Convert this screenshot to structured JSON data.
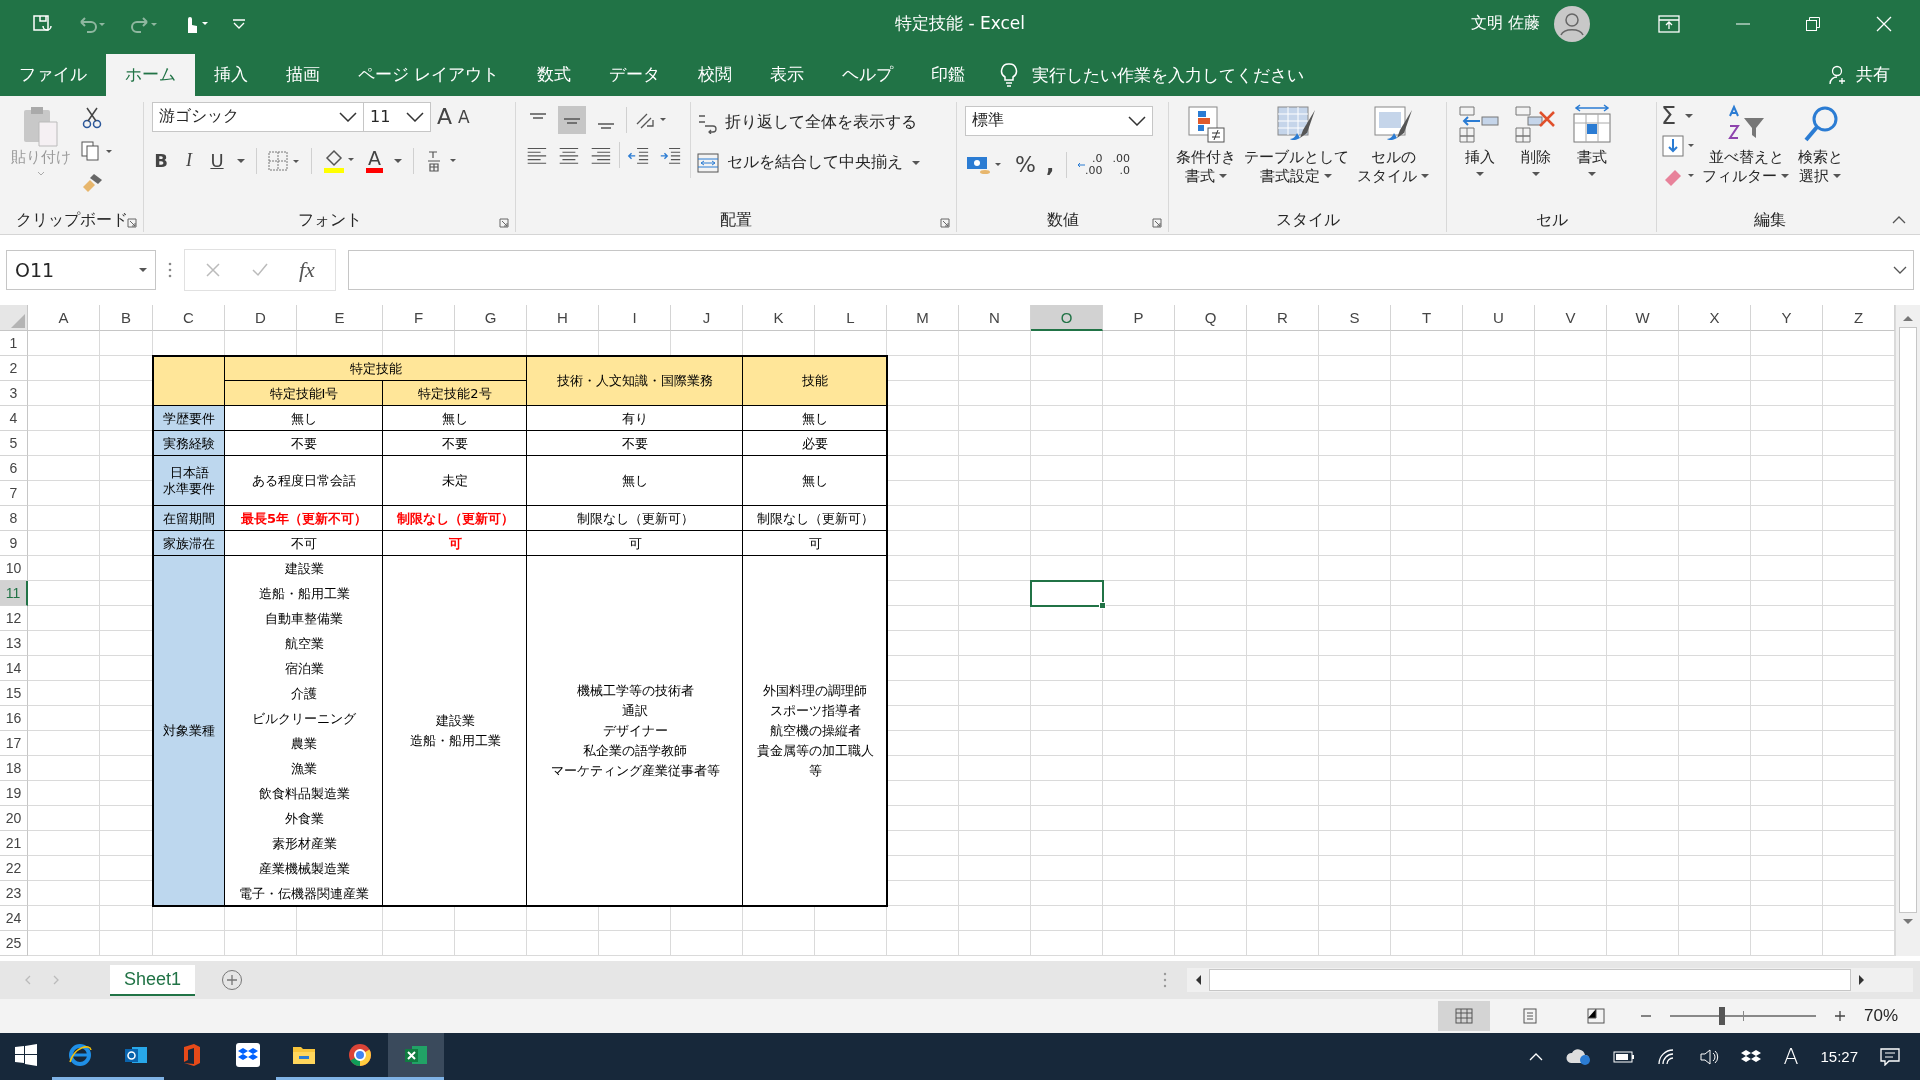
{
  "title_bar": {
    "title": "特定技能  -  Excel",
    "user_name": "文明 佐藤"
  },
  "menu_tabs": [
    {
      "label": "ファイル",
      "selected": false
    },
    {
      "label": "ホーム",
      "selected": true
    },
    {
      "label": "挿入",
      "selected": false
    },
    {
      "label": "描画",
      "selected": false
    },
    {
      "label": "ページ レイアウト",
      "selected": false
    },
    {
      "label": "数式",
      "selected": false
    },
    {
      "label": "データ",
      "selected": false
    },
    {
      "label": "校閲",
      "selected": false
    },
    {
      "label": "表示",
      "selected": false
    },
    {
      "label": "ヘルプ",
      "selected": false
    },
    {
      "label": "印鑑",
      "selected": false
    }
  ],
  "tell_me": {
    "placeholder": "実行したい作業を入力してください"
  },
  "share": "共有",
  "ribbon": {
    "clipboard": {
      "label": "クリップボード",
      "paste": "貼り付け"
    },
    "font": {
      "label": "フォント",
      "font_name": "游ゴシック",
      "font_size": "11",
      "grow": "A",
      "shrink": "A",
      "bold": "B",
      "italic": "I",
      "underline": "U",
      "font_color": "A"
    },
    "alignment": {
      "label": "配置",
      "wrap_text": "折り返して全体を表示する",
      "merge_center": "セルを結合して中央揃え"
    },
    "number": {
      "label": "数値",
      "format": "標準",
      "percent": "%",
      "comma": ",",
      "increase_decimal": [
        ".0",
        ".00"
      ],
      "decrease_decimal": [
        ".00",
        ".0"
      ]
    },
    "styles": {
      "label": "スタイル",
      "buttons": [
        {
          "lines": [
            "条件付き",
            "書式"
          ]
        },
        {
          "lines": [
            "テーブルとして",
            "書式設定"
          ]
        },
        {
          "lines": [
            "セルの",
            "スタイル"
          ]
        }
      ]
    },
    "cells": {
      "label": "セル",
      "buttons": [
        "挿入",
        "削除",
        "書式"
      ]
    },
    "editing": {
      "label": "編集",
      "autosum": "Σ",
      "buttons": [
        {
          "lines": [
            "並べ替えと",
            "フィルター"
          ]
        },
        {
          "lines": [
            "検索と",
            "選択"
          ]
        }
      ]
    }
  },
  "formula_bar": {
    "name_box": "O11",
    "function_label": "fx"
  },
  "sheet": {
    "columns": [
      {
        "label": "A",
        "selected": false
      },
      {
        "label": "B",
        "selected": false
      },
      {
        "label": "C",
        "selected": false
      },
      {
        "label": "D",
        "selected": false
      },
      {
        "label": "E",
        "selected": false
      },
      {
        "label": "F",
        "selected": false
      },
      {
        "label": "G",
        "selected": false
      },
      {
        "label": "H",
        "selected": false
      },
      {
        "label": "I",
        "selected": false
      },
      {
        "label": "J",
        "selected": false
      },
      {
        "label": "K",
        "selected": false
      },
      {
        "label": "L",
        "selected": false
      },
      {
        "label": "M",
        "selected": false
      },
      {
        "label": "N",
        "selected": false
      },
      {
        "label": "O",
        "selected": true
      },
      {
        "label": "P",
        "selected": false
      },
      {
        "label": "Q",
        "selected": false
      },
      {
        "label": "R",
        "selected": false
      },
      {
        "label": "S",
        "selected": false
      },
      {
        "label": "T",
        "selected": false
      },
      {
        "label": "U",
        "selected": false
      },
      {
        "label": "V",
        "selected": false
      },
      {
        "label": "W",
        "selected": false
      },
      {
        "label": "X",
        "selected": false
      },
      {
        "label": "Y",
        "selected": false
      },
      {
        "label": "Z",
        "selected": false
      }
    ],
    "rows": [
      {
        "label": "1",
        "selected": false
      },
      {
        "label": "2",
        "selected": false
      },
      {
        "label": "3",
        "selected": false
      },
      {
        "label": "4",
        "selected": false
      },
      {
        "label": "5",
        "selected": false
      },
      {
        "label": "6",
        "selected": false
      },
      {
        "label": "7",
        "selected": false
      },
      {
        "label": "8",
        "selected": false
      },
      {
        "label": "9",
        "selected": false
      },
      {
        "label": "10",
        "selected": false
      },
      {
        "label": "11",
        "selected": true
      },
      {
        "label": "12",
        "selected": false
      },
      {
        "label": "13",
        "selected": false
      },
      {
        "label": "14",
        "selected": false
      },
      {
        "label": "15",
        "selected": false
      },
      {
        "label": "16",
        "selected": false
      },
      {
        "label": "17",
        "selected": false
      },
      {
        "label": "18",
        "selected": false
      },
      {
        "label": "19",
        "selected": false
      },
      {
        "label": "20",
        "selected": false
      },
      {
        "label": "21",
        "selected": false
      },
      {
        "label": "22",
        "selected": false
      },
      {
        "label": "23",
        "selected": false
      },
      {
        "label": "24",
        "selected": false
      },
      {
        "label": "25",
        "selected": false
      }
    ],
    "table": {
      "group_header": "特定技能",
      "columns": [
        "特定技能Ⅰ号",
        "特定技能2号",
        "技術・人文知識・国際業務",
        "技能"
      ],
      "rows": [
        {
          "label_lines": [
            "学歴要件"
          ],
          "cells": [
            {
              "lines": [
                "無し"
              ],
              "highlighted": false
            },
            {
              "lines": [
                "無し"
              ],
              "highlighted": false
            },
            {
              "lines": [
                "有り"
              ],
              "highlighted": false
            },
            {
              "lines": [
                "無し"
              ],
              "highlighted": false
            }
          ]
        },
        {
          "label_lines": [
            "実務経験"
          ],
          "cells": [
            {
              "lines": [
                "不要"
              ],
              "highlighted": false
            },
            {
              "lines": [
                "不要"
              ],
              "highlighted": false
            },
            {
              "lines": [
                "不要"
              ],
              "highlighted": false
            },
            {
              "lines": [
                "必要"
              ],
              "highlighted": false
            }
          ]
        },
        {
          "label_lines": [
            "日本語",
            "水準要件"
          ],
          "cells": [
            {
              "lines": [
                "ある程度日常会話"
              ],
              "highlighted": false
            },
            {
              "lines": [
                "未定"
              ],
              "highlighted": false
            },
            {
              "lines": [
                "無し"
              ],
              "highlighted": false
            },
            {
              "lines": [
                "無し"
              ],
              "highlighted": false
            }
          ]
        },
        {
          "label_lines": [
            "在留期間"
          ],
          "cells": [
            {
              "lines": [
                "最長5年（更新不可）"
              ],
              "highlighted": true
            },
            {
              "lines": [
                "制限なし（更新可）"
              ],
              "highlighted": true
            },
            {
              "lines": [
                "制限なし（更新可）"
              ],
              "highlighted": false
            },
            {
              "lines": [
                "制限なし（更新可）"
              ],
              "highlighted": false
            }
          ]
        },
        {
          "label_lines": [
            "家族滞在"
          ],
          "cells": [
            {
              "lines": [
                "不可"
              ],
              "highlighted": false
            },
            {
              "lines": [
                "可"
              ],
              "highlighted": true
            },
            {
              "lines": [
                "可"
              ],
              "highlighted": false
            },
            {
              "lines": [
                "可"
              ],
              "highlighted": false
            }
          ]
        },
        {
          "label_lines": [
            "対象業種"
          ],
          "cells": [
            {
              "lines": [
                "建設業",
                "造船・船用工業",
                "自動車整備業",
                "航空業",
                "宿泊業",
                "介護",
                "ビルクリーニング",
                "農業",
                "漁業",
                "飲食料品製造業",
                "外食業",
                "素形材産業",
                "産業機械製造業",
                "電子・伝機器関連産業"
              ],
              "highlighted": false
            },
            {
              "lines": [
                "建設業",
                "造船・船用工業"
              ],
              "highlighted": false
            },
            {
              "lines": [
                "機械工学等の技術者",
                "通訳",
                "デザイナー",
                "私企業の語学教師",
                "マーケティング産業従事者等"
              ],
              "highlighted": false
            },
            {
              "lines": [
                "外国料理の調理師",
                "スポーツ指導者",
                "航空機の操縦者",
                "貴金属等の加工職人",
                "等"
              ],
              "highlighted": false
            }
          ]
        }
      ]
    }
  },
  "sheet_tabs": [
    {
      "label": "Sheet1",
      "selected": true
    }
  ],
  "status_bar": {
    "views": [
      {
        "kind": "normal",
        "selected": true
      },
      {
        "kind": "page-layout",
        "selected": false
      },
      {
        "kind": "page-break",
        "selected": false
      }
    ],
    "zoom": {
      "level": 0.35,
      "reading": "70%"
    }
  },
  "taskbar": {
    "apps": [
      {
        "kind": "browser",
        "running": true,
        "selected": false
      },
      {
        "kind": "mail",
        "running": true,
        "selected": false
      },
      {
        "kind": "office",
        "running": false,
        "selected": false
      },
      {
        "kind": "box",
        "running": false,
        "selected": false
      },
      {
        "kind": "folder",
        "running": true,
        "selected": false
      },
      {
        "kind": "chrome",
        "running": true,
        "selected": false
      },
      {
        "kind": "spreadsheet",
        "running": true,
        "selected": true
      }
    ],
    "ime": "A",
    "time": "15:27"
  }
}
